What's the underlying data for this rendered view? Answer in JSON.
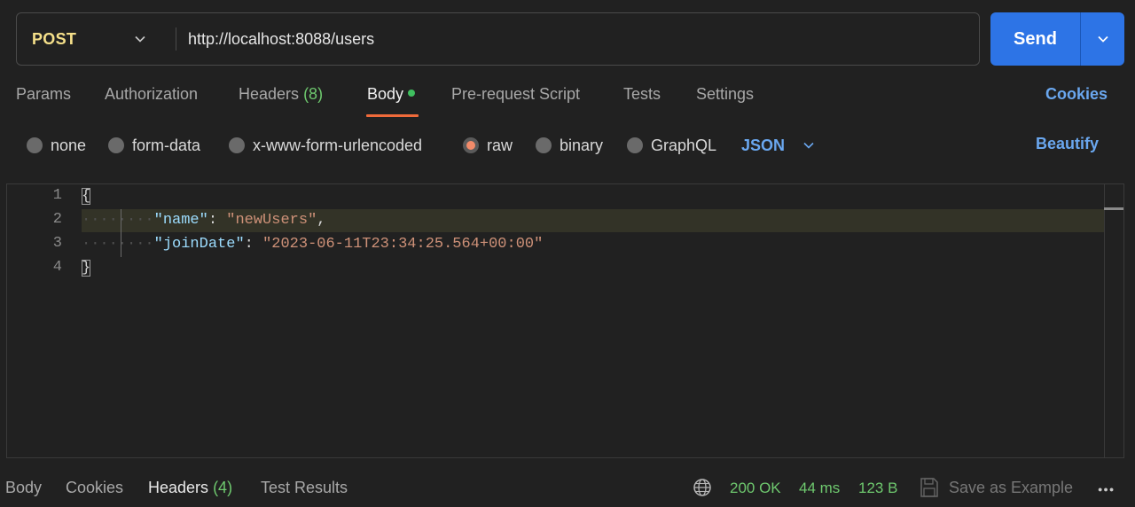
{
  "request": {
    "method": "POST",
    "url": "http://localhost:8088/users",
    "send_label": "Send"
  },
  "tabs": [
    {
      "label": "Params"
    },
    {
      "label": "Authorization"
    },
    {
      "label": "Headers",
      "count": "(8)"
    },
    {
      "label": "Body",
      "active": true
    },
    {
      "label": "Pre-request Script"
    },
    {
      "label": "Tests"
    },
    {
      "label": "Settings"
    }
  ],
  "cookies_label": "Cookies",
  "body_types": [
    {
      "label": "none"
    },
    {
      "label": "form-data"
    },
    {
      "label": "x-www-form-urlencoded"
    },
    {
      "label": "raw",
      "selected": true
    },
    {
      "label": "binary"
    },
    {
      "label": "GraphQL"
    }
  ],
  "format": "JSON",
  "beautify_label": "Beautify",
  "editor": {
    "line_numbers": [
      "1",
      "2",
      "3",
      "4"
    ],
    "open_brace": "{",
    "close_brace": "}",
    "name_key": "\"name\"",
    "name_value": "\"newUsers\"",
    "join_key": "\"joinDate\"",
    "join_value": "\"2023-06-11T23:34:25.564+00:00\""
  },
  "response": {
    "tabs": [
      {
        "label": "Body"
      },
      {
        "label": "Cookies"
      },
      {
        "label": "Headers",
        "count": "(4)",
        "active": true
      },
      {
        "label": "Test Results"
      }
    ],
    "status": "200 OK",
    "time": "44 ms",
    "size": "123 B",
    "save_example": "Save as Example",
    "more": "ooo"
  },
  "colors": {
    "accent_blue": "#2d74e6",
    "active_tab_underline": "#ef6a3a",
    "method_yellow": "#f5e08a",
    "status_green": "#6ec86e"
  }
}
